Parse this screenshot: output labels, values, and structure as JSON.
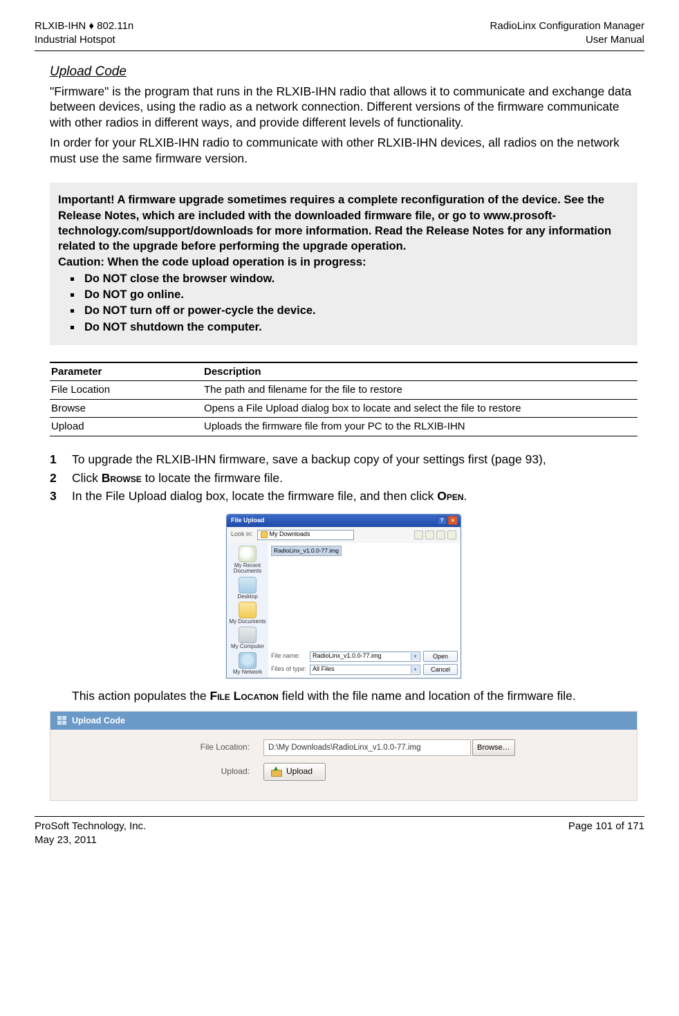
{
  "header": {
    "left1": "RLXIB-IHN ♦ 802.11n",
    "left2": "Industrial Hotspot",
    "right1": "RadioLinx Configuration Manager",
    "right2": "User Manual"
  },
  "section_title": "Upload Code",
  "para1": "\"Firmware\" is the program that runs in the RLXIB-IHN radio that allows it to communicate and exchange data between devices, using the radio as a network connection. Different versions of the firmware communicate with other radios in different ways, and provide different levels of functionality.",
  "para2": "In order for your RLXIB-IHN radio to communicate with other RLXIB-IHN devices, all radios on the network must use the same firmware version.",
  "important": {
    "p1": "Important! A firmware upgrade sometimes requires a complete reconfiguration of the device. See the Release Notes, which are included with the downloaded firmware file, or go to www.prosoft-technology.com/support/downloads for more information. Read the Release Notes for any information related to the upgrade before performing the upgrade operation.",
    "p2": "Caution: When the code upload operation is in progress:",
    "items": [
      "Do NOT close the browser window.",
      "Do NOT go online.",
      "Do NOT turn off or power-cycle the device.",
      "Do NOT shutdown the computer."
    ]
  },
  "table": {
    "h1": "Parameter",
    "h2": "Description",
    "rows": [
      {
        "p": "File Location",
        "d": "The path and filename for the file to restore"
      },
      {
        "p": "Browse",
        "d": "Opens a File Upload dialog box to locate and select the file to restore"
      },
      {
        "p": "Upload",
        "d": "Uploads the firmware file from your PC to the RLXIB-IHN"
      }
    ]
  },
  "steps": {
    "s1": "To upgrade the RLXIB-IHN firmware, save a backup copy of your settings first (page 93),",
    "s2a": "Click ",
    "s2b": "Browse",
    "s2c": " to locate the firmware file.",
    "s3a": "In the File Upload dialog box, locate the firmware file, and then click ",
    "s3b": "Open",
    "s3c": "."
  },
  "dialog": {
    "title": "File Upload",
    "lookin_label": "Look in:",
    "lookin_value": "My Downloads",
    "selected_file": "RadioLinx_v1.0.0-77.img",
    "side": {
      "recent": "My Recent Documents",
      "desktop": "Desktop",
      "mydocs": "My Documents",
      "mycomp": "My Computer",
      "mynet": "My Network"
    },
    "filename_label": "File name:",
    "filename_value": "RadioLinx_v1.0.0-77.img",
    "filetype_label": "Files of type:",
    "filetype_value": "All Files",
    "open_btn": "Open",
    "cancel_btn": "Cancel"
  },
  "populate_a": "This action populates the ",
  "populate_b": "File Location",
  "populate_c": " field with the file name and location of the firmware file.",
  "upload_panel": {
    "title": "Upload Code",
    "file_location_label": "File Location:",
    "file_location_value": "D:\\My Downloads\\RadioLinx_v1.0.0-77.img",
    "browse_btn": "Browse…",
    "upload_label": "Upload:",
    "upload_btn": "Upload"
  },
  "footer": {
    "left1": "ProSoft Technology, Inc.",
    "left2": "May 23, 2011",
    "right1": "Page 101 of 171"
  }
}
